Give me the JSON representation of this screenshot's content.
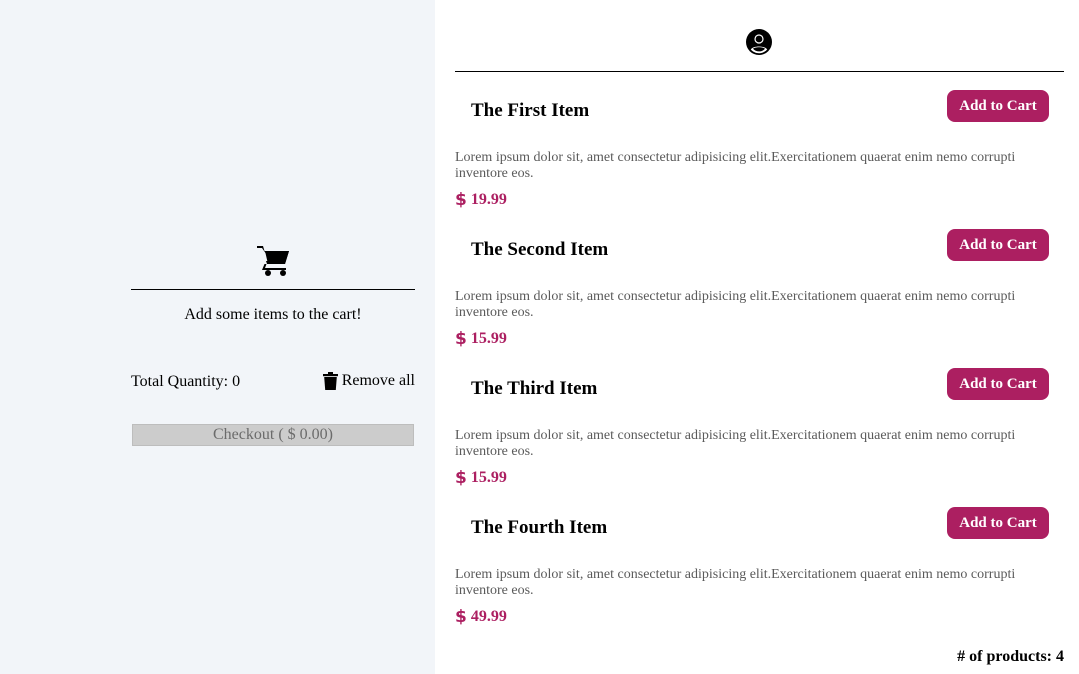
{
  "cart": {
    "icon": "shopping-cart-icon",
    "empty_message": "Add some items to the cart!",
    "total_quantity_label": "Total Quantity: 0",
    "remove_all_icon": "trash-icon",
    "remove_all_label": "Remove all",
    "checkout_label": "Checkout ( $ 0.00)"
  },
  "header": {
    "user_icon": "user-circle-icon"
  },
  "products": [
    {
      "title": "The First Item",
      "add_label": "Add to Cart",
      "description": "Lorem ipsum dolor sit, amet consectetur adipisicing elit.Exercitationem quaerat enim nemo corrupti inventore eos.",
      "price": "19.99"
    },
    {
      "title": "The Second Item",
      "add_label": "Add to Cart",
      "description": "Lorem ipsum dolor sit, amet consectetur adipisicing elit.Exercitationem quaerat enim nemo corrupti inventore eos.",
      "price": "15.99"
    },
    {
      "title": "The Third Item",
      "add_label": "Add to Cart",
      "description": "Lorem ipsum dolor sit, amet consectetur adipisicing elit.Exercitationem quaerat enim nemo corrupti inventore eos.",
      "price": "15.99"
    },
    {
      "title": "The Fourth Item",
      "add_label": "Add to Cart",
      "description": "Lorem ipsum dolor sit, amet consectetur adipisicing elit.Exercitationem quaerat enim nemo corrupti inventore eos.",
      "price": "49.99"
    }
  ],
  "footer": {
    "product_count": "# of products: 4"
  },
  "colors": {
    "accent": "#ac1f61",
    "sidebar_bg": "#f2f5f9",
    "checkout_bg": "#cccccc"
  }
}
